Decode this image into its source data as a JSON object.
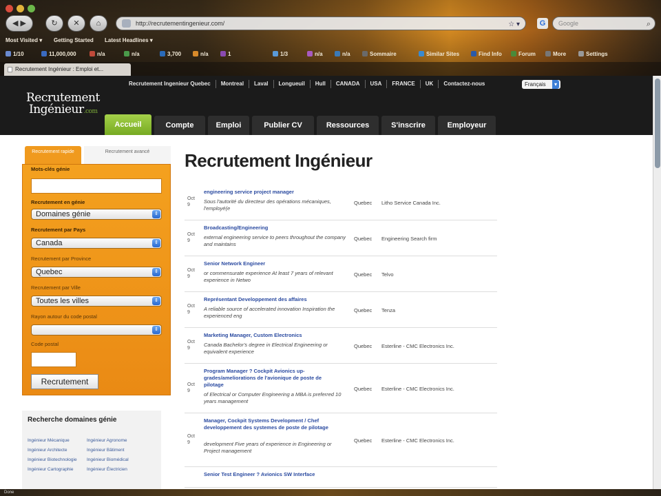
{
  "browser": {
    "url": "http://recrutementingenieur.com/",
    "search_placeholder": "Google",
    "tab_title": "Recrutement Ingénieur : Emploi et...",
    "status": "Done",
    "bookmarks": [
      "Most Visited ▾",
      "Getting Started",
      "Latest Headlines ▾"
    ],
    "toolbar_items": [
      "1/10",
      "11,000,000",
      "n/a",
      "n/a",
      "3,700",
      "n/a",
      "1",
      "1/3",
      "n/a",
      "n/a",
      "Sommaire",
      "Similar Sites",
      "Find Info",
      "Forum",
      "More",
      "Settings"
    ]
  },
  "site": {
    "logo_line1": "Recrutement",
    "logo_line2": "Ingénieur",
    "logo_suffix": ".com",
    "top_links": [
      "Recrutement Ingenieur Quebec",
      "Montreal",
      "Laval",
      "Longueuil",
      "Hull",
      "CANADA",
      "USA",
      "FRANCE",
      "UK",
      "Contactez-nous"
    ],
    "language": "Français",
    "nav": [
      "Accueil",
      "Compte",
      "Emploi",
      "Publier CV",
      "Ressources",
      "S'inscrire",
      "Employeur"
    ]
  },
  "search_panel": {
    "tab_quick": "Recrutement rapide",
    "tab_advanced": "Recrutement avancé",
    "keyword_label": "Mots-clés génie",
    "domain_label": "Recrutement en génie",
    "domain_value": "Domaines génie",
    "country_label": "Recrutement par Pays",
    "country_value": "Canada",
    "province_label": "Recrutement par Province",
    "province_value": "Quebec",
    "city_label": "Recrutement par Ville",
    "city_value": "Toutes les villes",
    "radius_label": "Rayon autour du code postal",
    "radius_value": "",
    "zip_label": "Code postal",
    "submit_label": "Recrutement"
  },
  "domains_box": {
    "title": "Recherche domaines génie",
    "links": [
      "Ingénieur Mécanique",
      "Ingénieur Agronome",
      "Ingénieur Architecte",
      "Ingénieur Bâtiment",
      "Ingénieur Biotechnologie",
      "Ingénieur Biomédical",
      "Ingénieur Cartographie",
      "Ingénieur Électricien"
    ]
  },
  "main": {
    "title": "Recrutement Ingénieur",
    "jobs": [
      {
        "date_month": "Oct",
        "date_day": "9",
        "title": "engineering service project manager",
        "desc": "Sous l'autorité du directeur des opérations mécaniques, l'employé(e",
        "location": "Quebec",
        "company": "Litho Service Canada Inc."
      },
      {
        "date_month": "Oct",
        "date_day": "9",
        "title": "Broadcasting/Engineering",
        "desc": "external engineering service to peers throughout the company and maintains",
        "location": "Quebec",
        "company": "Engineering Search firm"
      },
      {
        "date_month": "Oct",
        "date_day": "9",
        "title": "Senior Network Engineer",
        "desc": "or commensurate experience At least 7 years of relevant experience in Netwo",
        "location": "Quebec",
        "company": "Telvo"
      },
      {
        "date_month": "Oct",
        "date_day": "9",
        "title": "Représentant Developpement des affaires",
        "desc": "A reliable source of accelerated innovation Inspiration the experienced eng",
        "location": "Quebec",
        "company": "Tenza"
      },
      {
        "date_month": "Oct",
        "date_day": "9",
        "title": "Marketing Manager, Custom Electronics",
        "desc": "Canada Bachelor's degree in Electrical Engineering or equivalent experience",
        "location": "Quebec",
        "company": "Esterline - CMC Electronics Inc."
      },
      {
        "date_month": "Oct",
        "date_day": "9",
        "title": "Program Manager ? Cockpit Avionics up-grades/ameliorations de l'avionique de poste de pilotage",
        "desc": "of Electrical or Computer Engineering a MBA is preferred 10 years management",
        "location": "Quebec",
        "company": "Esterline - CMC Electronics Inc."
      },
      {
        "date_month": "Oct",
        "date_day": "9",
        "title": "Manager, Cockpit Systems Development / Chef developpement des systemes de poste de pilotage",
        "desc": "development Five years of experience in Engineering or Project management",
        "location": "Quebec",
        "company": "Esterline - CMC Electronics Inc."
      },
      {
        "date_month": "",
        "date_day": "",
        "title": "Senior Test Engineer ? Avionics SW Interface",
        "desc": "",
        "location": "",
        "company": ""
      }
    ]
  }
}
